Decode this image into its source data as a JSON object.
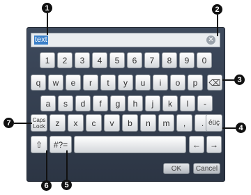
{
  "input": {
    "value": "text",
    "clear_glyph": "✕"
  },
  "rows": {
    "numbers": [
      "1",
      "2",
      "3",
      "4",
      "5",
      "6",
      "7",
      "8",
      "9",
      "0"
    ],
    "row1": [
      "q",
      "w",
      "e",
      "r",
      "t",
      "y",
      "u",
      "i",
      "o",
      "p"
    ],
    "row2": [
      "a",
      "s",
      "d",
      "f",
      "g",
      "h",
      "j",
      "k",
      "l",
      "-"
    ],
    "row3": [
      "z",
      "x",
      "c",
      "v",
      "b",
      "n",
      "m",
      ",",
      "."
    ]
  },
  "keys": {
    "backspace_glyph": "⌫",
    "caps": "Caps Lock",
    "accents": "éüç",
    "shift_glyph": "⇧",
    "symbols": "#?=",
    "left_glyph": "←",
    "right_glyph": "→"
  },
  "buttons": {
    "ok": "OK",
    "cancel": "Cancel"
  },
  "callouts": [
    "1",
    "2",
    "3",
    "4",
    "5",
    "6",
    "7"
  ],
  "colors": {
    "panel": "#2c3544",
    "selection": "#3a7fc9",
    "callout": "#111111"
  }
}
